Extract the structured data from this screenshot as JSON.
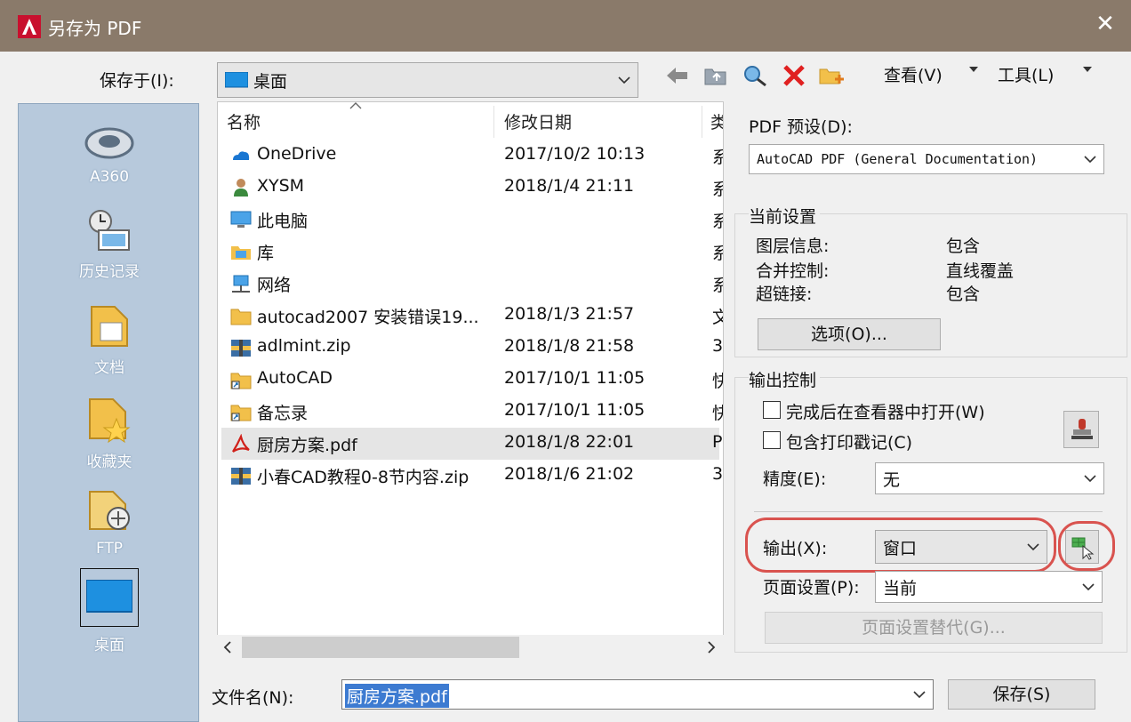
{
  "window": {
    "title": "另存为 PDF",
    "close_glyph": "✕"
  },
  "save_in": {
    "label": "保存于(I):",
    "value": "桌面"
  },
  "toolbar": {
    "view_label": "查看(V)",
    "tools_label": "工具(L)"
  },
  "places": [
    "A360",
    "历史记录",
    "文档",
    "收藏夹",
    "FTP",
    "桌面"
  ],
  "file_list": {
    "headers": [
      "名称",
      "修改日期",
      "类"
    ],
    "rows": [
      {
        "name": "OneDrive",
        "date": "2017/10/2 10:13",
        "type": "系",
        "icon": "onedrive-icon"
      },
      {
        "name": "XYSM",
        "date": "2018/1/4 21:11",
        "type": "系",
        "icon": "user-icon"
      },
      {
        "name": "此电脑",
        "date": "",
        "type": "系",
        "icon": "computer-icon"
      },
      {
        "name": "库",
        "date": "",
        "type": "系",
        "icon": "library-icon"
      },
      {
        "name": "网络",
        "date": "",
        "type": "系",
        "icon": "network-icon"
      },
      {
        "name": "autocad2007 安装错误19...",
        "date": "2018/1/3 21:57",
        "type": "文",
        "icon": "folder-icon"
      },
      {
        "name": "adlmint.zip",
        "date": "2018/1/8 21:58",
        "type": "3",
        "icon": "zip-icon"
      },
      {
        "name": "AutoCAD",
        "date": "2017/10/1 11:05",
        "type": "快",
        "icon": "shortcut-icon"
      },
      {
        "name": "备忘录",
        "date": "2017/10/1 11:05",
        "type": "快",
        "icon": "shortcut-icon"
      },
      {
        "name": "厨房方案.pdf",
        "date": "2018/1/8 22:01",
        "type": "P",
        "icon": "pdf-icon"
      },
      {
        "name": "小春CAD教程0-8节内容.zip",
        "date": "2018/1/6 21:02",
        "type": "3",
        "icon": "zip-icon"
      }
    ]
  },
  "pdf_preset": {
    "label": "PDF 预设(D):",
    "value": "AutoCAD PDF (General Documentation)"
  },
  "current_settings": {
    "title": "当前设置",
    "items": [
      {
        "key": "图层信息:",
        "value": "包含"
      },
      {
        "key": "合并控制:",
        "value": "直线覆盖"
      },
      {
        "key": "超链接:",
        "value": "包含"
      }
    ],
    "options_button": "选项(O)..."
  },
  "output_control": {
    "title": "输出控制",
    "open_in_viewer": "完成后在查看器中打开(W)",
    "include_plot_stamp": "包含打印戳记(C)",
    "precision_label": "精度(E):",
    "precision_value": "无"
  },
  "output": {
    "label": "输出(X):",
    "value": "窗口"
  },
  "page_setup": {
    "label": "页面设置(P):",
    "value": "当前",
    "override_button": "页面设置替代(G)..."
  },
  "filename": {
    "label": "文件名(N):",
    "value": "厨房方案.pdf"
  },
  "save_button": "保存(S)",
  "colors": {
    "titlebar": "#8a7a6a",
    "places": "#b7c9dc",
    "highlight": "#d9534f",
    "selection": "#3d7bd1"
  }
}
